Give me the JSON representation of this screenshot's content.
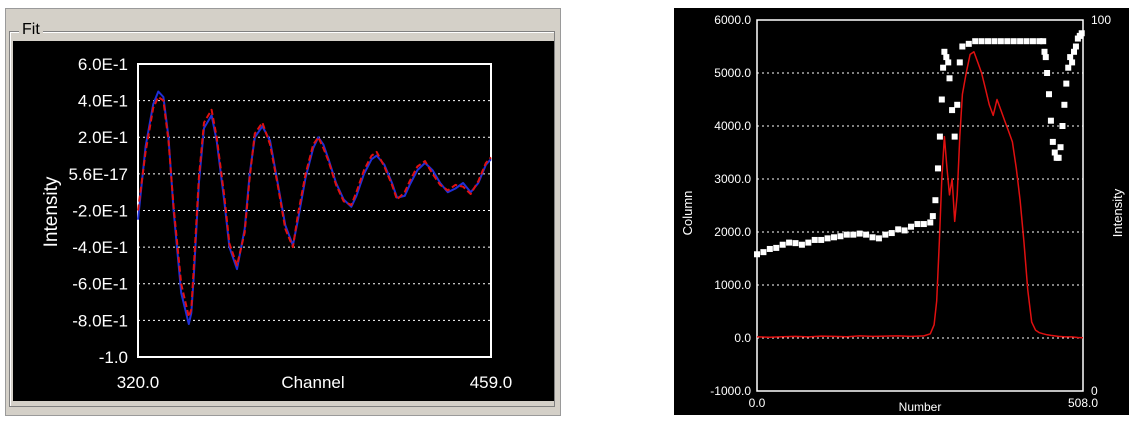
{
  "chart_data": [
    {
      "type": "line",
      "panel_title": "Fit",
      "xlabel": "Channel",
      "ylabel": "Intensity",
      "xlim": [
        320.0,
        459.0
      ],
      "ylim": [
        -1.0,
        0.6
      ],
      "x_tick_labels": [
        "320.0",
        "459.0"
      ],
      "y_tick_labels": [
        "6.0E-1",
        "4.0E-1",
        "2.0E-1",
        "5.6E-17",
        "-2.0E-1",
        "-4.0E-1",
        "-6.0E-1",
        "-8.0E-1",
        "-1.0"
      ],
      "y_tick_values": [
        0.6,
        0.4,
        0.2,
        0.0,
        -0.2,
        -0.4,
        -0.6,
        -0.8,
        -1.0
      ],
      "grid": "horizontal dotted",
      "series": [
        {
          "color": "#1f2fd8",
          "style": "solid",
          "x": [
            320,
            323,
            326,
            328,
            330,
            332,
            334,
            337,
            340,
            341,
            342,
            344,
            346,
            349,
            351,
            354,
            356,
            359,
            362,
            364,
            366,
            369,
            372,
            375,
            378,
            381,
            383,
            386,
            389,
            391,
            393,
            395,
            398,
            401,
            404,
            406,
            409,
            412,
            414,
            417,
            420,
            422,
            425,
            427,
            430,
            433,
            436,
            439,
            442,
            445,
            448,
            451,
            454,
            457,
            459
          ],
          "y": [
            -0.25,
            0.15,
            0.38,
            0.45,
            0.42,
            0.2,
            -0.2,
            -0.65,
            -0.82,
            -0.76,
            -0.55,
            -0.05,
            0.25,
            0.32,
            0.18,
            -0.15,
            -0.4,
            -0.52,
            -0.3,
            0.0,
            0.2,
            0.26,
            0.18,
            -0.05,
            -0.28,
            -0.39,
            -0.25,
            -0.02,
            0.14,
            0.2,
            0.16,
            0.08,
            -0.05,
            -0.14,
            -0.18,
            -0.12,
            0.0,
            0.08,
            0.1,
            0.05,
            -0.05,
            -0.13,
            -0.12,
            -0.06,
            0.02,
            0.06,
            0.02,
            -0.05,
            -0.1,
            -0.08,
            -0.05,
            -0.1,
            -0.05,
            0.05,
            0.08
          ]
        },
        {
          "color": "#e01010",
          "style": "dashed",
          "x": [
            320,
            323,
            326,
            328,
            330,
            332,
            334,
            337,
            340,
            341,
            342,
            344,
            346,
            349,
            351,
            354,
            356,
            359,
            362,
            364,
            366,
            369,
            372,
            375,
            378,
            381,
            383,
            386,
            389,
            391,
            393,
            395,
            398,
            401,
            404,
            406,
            409,
            412,
            414,
            417,
            420,
            422,
            425,
            427,
            430,
            433,
            436,
            439,
            442,
            445,
            448,
            451,
            454,
            457,
            459
          ],
          "y": [
            -0.2,
            0.12,
            0.36,
            0.42,
            0.4,
            0.18,
            -0.18,
            -0.6,
            -0.78,
            -0.74,
            -0.5,
            -0.02,
            0.28,
            0.35,
            0.2,
            -0.12,
            -0.38,
            -0.5,
            -0.32,
            -0.02,
            0.22,
            0.28,
            0.16,
            -0.06,
            -0.3,
            -0.4,
            -0.22,
            0.0,
            0.16,
            0.2,
            0.14,
            0.07,
            -0.06,
            -0.15,
            -0.17,
            -0.1,
            0.02,
            0.1,
            0.12,
            0.04,
            -0.06,
            -0.14,
            -0.1,
            -0.04,
            0.04,
            0.07,
            0.0,
            -0.06,
            -0.09,
            -0.06,
            -0.07,
            -0.11,
            -0.04,
            0.06,
            0.09
          ]
        }
      ]
    },
    {
      "type": "line",
      "xlabel": "Number",
      "ylabel": "Column",
      "y2label": "Intensity",
      "xlim": [
        0.0,
        508.0
      ],
      "ylim": [
        -1000.0,
        6000.0
      ],
      "y2lim": [
        0,
        100
      ],
      "x_tick_labels": [
        "0.0",
        "508.0"
      ],
      "y_tick_labels": [
        "6000.0",
        "5000.0",
        "4000.0",
        "3000.0",
        "2000.0",
        "1000.0",
        "0.0",
        "-1000.0"
      ],
      "y_tick_values": [
        6000,
        5000,
        4000,
        3000,
        2000,
        1000,
        0,
        -1000
      ],
      "y2_tick_labels": [
        "100",
        "0"
      ],
      "y2_tick_values": [
        100,
        0
      ],
      "grid": "horizontal dotted",
      "series": [
        {
          "color": "#ffffff",
          "style": "dots",
          "axis": "left",
          "x": [
            0,
            10,
            20,
            30,
            40,
            50,
            60,
            70,
            80,
            90,
            100,
            110,
            120,
            130,
            140,
            150,
            160,
            170,
            180,
            190,
            200,
            210,
            220,
            230,
            240,
            250,
            260,
            270,
            274,
            278,
            282,
            285,
            288,
            290,
            292,
            295,
            298,
            300,
            304,
            308,
            312,
            316,
            320,
            330,
            340,
            350,
            360,
            370,
            380,
            390,
            400,
            410,
            420,
            430,
            440,
            446,
            448,
            450,
            452,
            455,
            458,
            461,
            464,
            467,
            470,
            473,
            476,
            479,
            482,
            485,
            488,
            491,
            494,
            497,
            500,
            503,
            506
          ],
          "y": [
            1580,
            1620,
            1680,
            1700,
            1760,
            1800,
            1790,
            1760,
            1800,
            1850,
            1850,
            1880,
            1900,
            1920,
            1950,
            1950,
            1970,
            1950,
            1900,
            1880,
            1950,
            1980,
            2050,
            2030,
            2100,
            2150,
            2150,
            2180,
            2300,
            2600,
            3200,
            3800,
            4500,
            5100,
            5400,
            5300,
            5200,
            4900,
            4300,
            3800,
            4400,
            5200,
            5500,
            5550,
            5600,
            5600,
            5600,
            5600,
            5600,
            5600,
            5600,
            5600,
            5600,
            5600,
            5600,
            5600,
            5400,
            5300,
            5000,
            4600,
            4100,
            3700,
            3500,
            3400,
            3400,
            3600,
            4000,
            4400,
            4800,
            5100,
            5300,
            5200,
            5400,
            5500,
            5650,
            5700,
            5750
          ]
        },
        {
          "color": "#e01010",
          "style": "solid",
          "axis": "left",
          "x": [
            0,
            20,
            40,
            60,
            80,
            100,
            120,
            140,
            160,
            180,
            200,
            220,
            240,
            260,
            270,
            276,
            280,
            284,
            288,
            292,
            296,
            300,
            304,
            308,
            312,
            316,
            320,
            326,
            332,
            338,
            344,
            350,
            356,
            362,
            368,
            374,
            380,
            386,
            392,
            398,
            404,
            410,
            416,
            422,
            428,
            434,
            440,
            446,
            452,
            458,
            464,
            470,
            480,
            490,
            500,
            508
          ],
          "y": [
            20,
            15,
            25,
            30,
            20,
            35,
            30,
            25,
            40,
            30,
            35,
            40,
            30,
            40,
            80,
            250,
            700,
            1800,
            3000,
            3800,
            3200,
            2700,
            3000,
            2200,
            2700,
            3800,
            4600,
            5000,
            5350,
            5400,
            5200,
            5000,
            4700,
            4400,
            4200,
            4500,
            4300,
            4100,
            3900,
            3700,
            3200,
            2600,
            1800,
            900,
            300,
            150,
            100,
            80,
            60,
            50,
            40,
            30,
            20,
            20,
            10,
            5
          ]
        }
      ]
    }
  ]
}
